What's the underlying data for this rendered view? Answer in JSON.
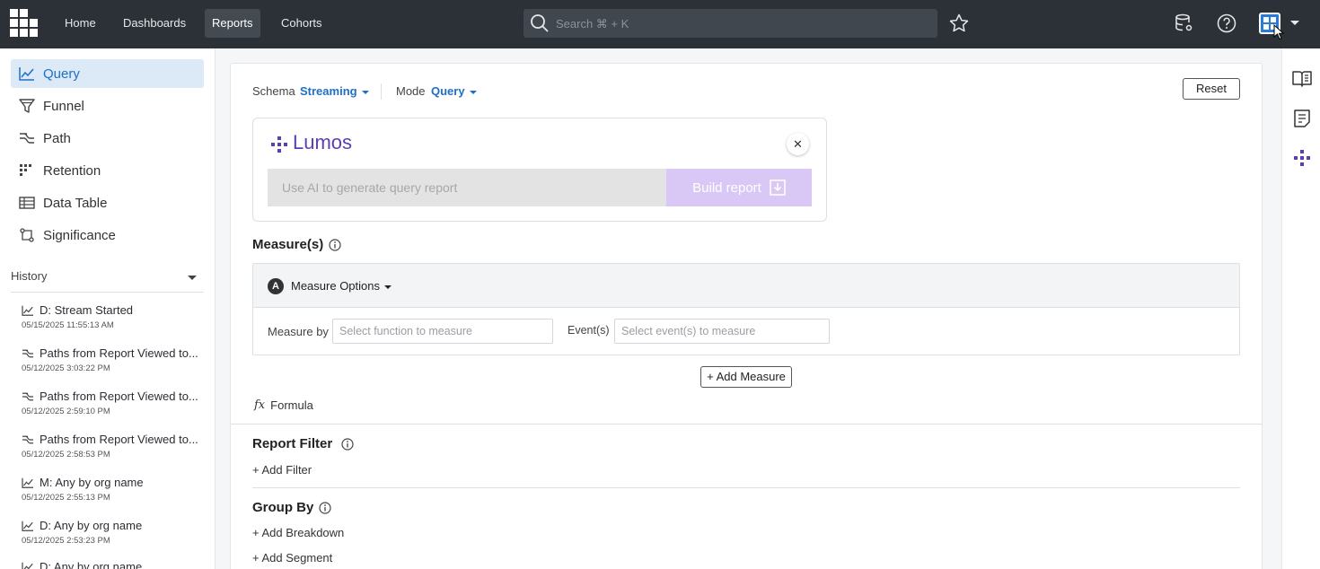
{
  "nav": {
    "items": [
      {
        "label": "Home"
      },
      {
        "label": "Dashboards"
      },
      {
        "label": "Reports"
      },
      {
        "label": "Cohorts"
      }
    ],
    "search_placeholder": "Search ⌘ + K"
  },
  "sidebar": {
    "items": [
      {
        "label": "Query",
        "icon": "line-chart-icon"
      },
      {
        "label": "Funnel",
        "icon": "funnel-icon"
      },
      {
        "label": "Path",
        "icon": "path-icon"
      },
      {
        "label": "Retention",
        "icon": "retention-icon"
      },
      {
        "label": "Data Table",
        "icon": "table-icon"
      },
      {
        "label": "Significance",
        "icon": "significance-icon"
      }
    ],
    "history_label": "History",
    "history": [
      {
        "title": "D: Stream Started",
        "date": "05/15/2025 11:55:13 AM",
        "icon": "line-chart-icon"
      },
      {
        "title": "Paths from Report Viewed to...",
        "date": "05/12/2025 3:03:22 PM",
        "icon": "path-icon"
      },
      {
        "title": "Paths from Report Viewed to...",
        "date": "05/12/2025 2:59:10 PM",
        "icon": "path-icon"
      },
      {
        "title": "Paths from Report Viewed to...",
        "date": "05/12/2025 2:58:53 PM",
        "icon": "path-icon"
      },
      {
        "title": "M: Any by org name",
        "date": "05/12/2025 2:55:13 PM",
        "icon": "line-chart-icon"
      },
      {
        "title": "D: Any by org name",
        "date": "05/12/2025 2:53:23 PM",
        "icon": "line-chart-icon"
      },
      {
        "title": "D: Any by org name",
        "date": "",
        "icon": "line-chart-icon"
      }
    ]
  },
  "report": {
    "schema_label": "Schema",
    "schema_value": "Streaming",
    "mode_label": "Mode",
    "mode_value": "Query",
    "reset_label": "Reset"
  },
  "lumos": {
    "title": "Lumos",
    "close_glyph": "✕",
    "input_placeholder": "Use AI to generate query report",
    "build_label": "Build report",
    "accent": "#5b3fb0"
  },
  "measures": {
    "title": "Measure(s)",
    "badge": "A",
    "options_label": "Measure Options",
    "measure_by_label": "Measure by",
    "measure_by_placeholder": "Select function to measure",
    "events_label": "Event(s)",
    "events_placeholder": "Select event(s) to measure",
    "add_label": "+ Add Measure",
    "formula_label": "Formula",
    "formula_glyph": "fx"
  },
  "filter": {
    "title": "Report Filter",
    "add_label": "+ Add Filter"
  },
  "group": {
    "title": "Group By",
    "add_breakdown": "+ Add Breakdown",
    "add_segment": "+ Add Segment"
  },
  "colors": {
    "topbar": "#2c3138",
    "accent_blue": "#1f6fc6",
    "active_bg": "#dce9f7"
  }
}
